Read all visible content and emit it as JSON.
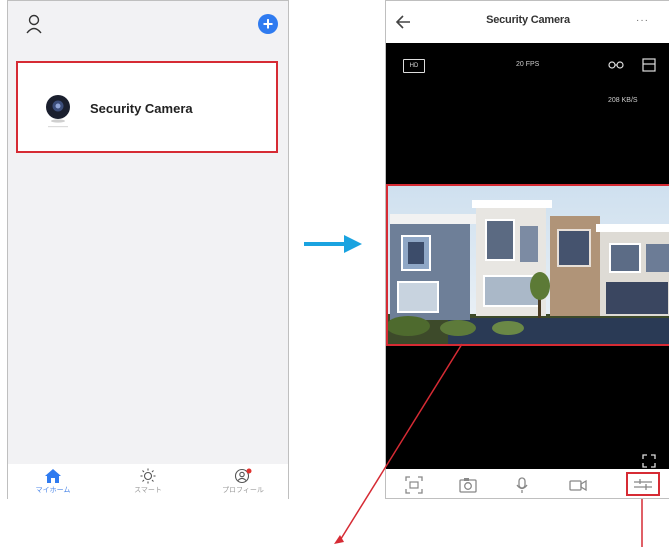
{
  "left_screen": {
    "device": {
      "name": "Security Camera"
    },
    "tabs": [
      {
        "label": "マイホーム",
        "active": true
      },
      {
        "label": "スマート",
        "active": false
      },
      {
        "label": "プロフィール",
        "active": false
      }
    ]
  },
  "right_screen": {
    "header": {
      "title": "Security Camera",
      "more": "···"
    },
    "stream": {
      "quality_badge": "HD",
      "fps": "20 FPS",
      "bitrate": "208 KB/S"
    }
  },
  "colors": {
    "highlight": "#d62b34",
    "accent_blue": "#2f7bf0",
    "arrow": "#1aa3e0"
  }
}
